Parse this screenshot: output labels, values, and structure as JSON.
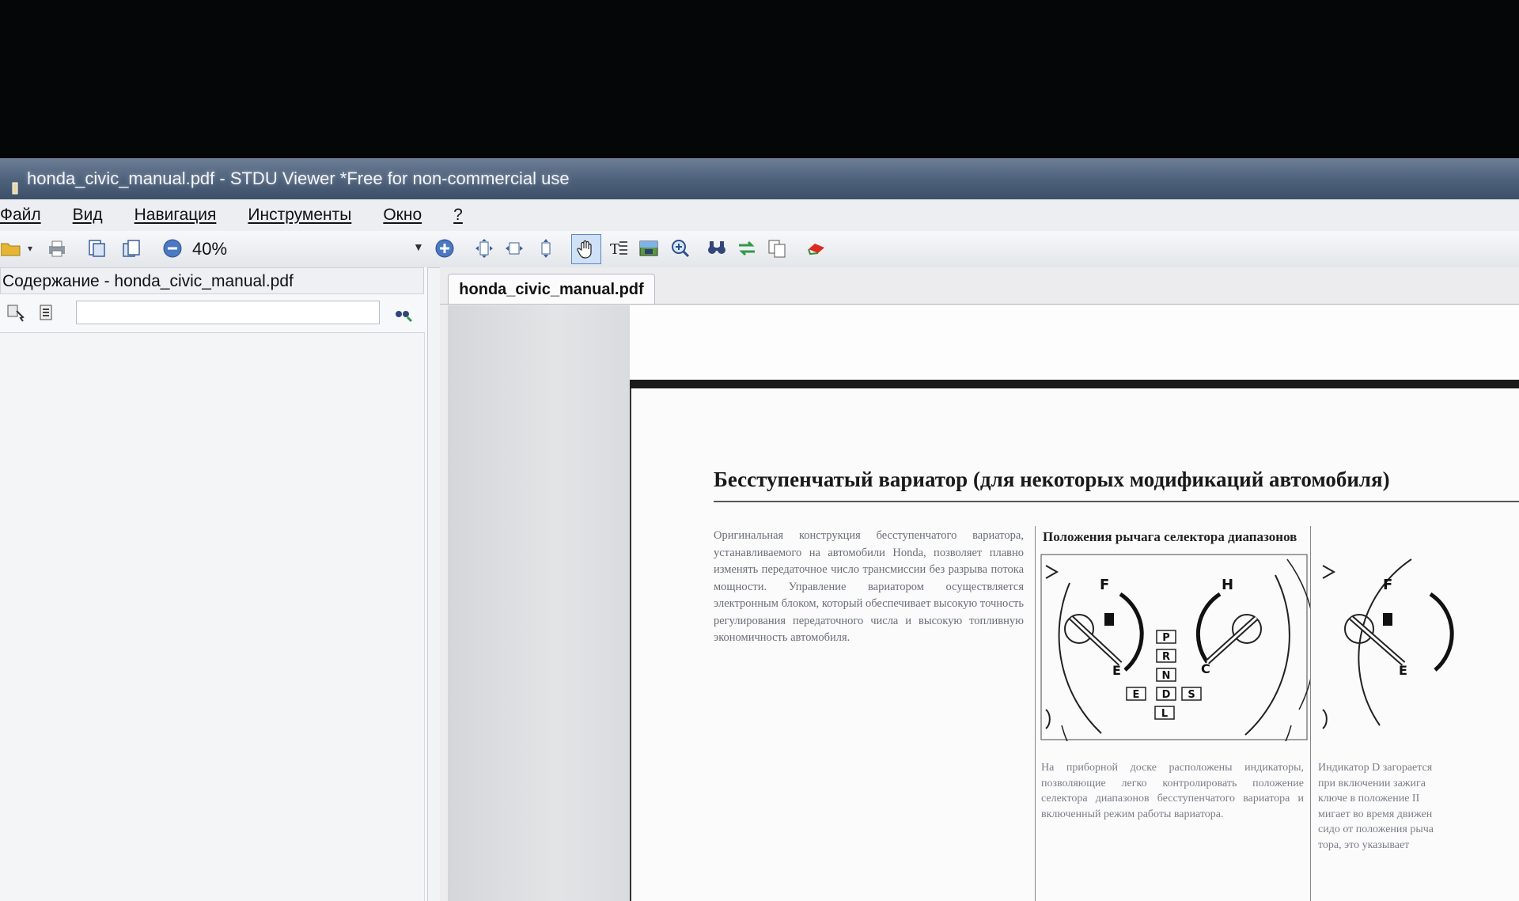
{
  "window": {
    "title": "honda_civic_manual.pdf - STDU Viewer *Free for non-commercial use"
  },
  "menu": {
    "items": [
      "Файл",
      "Вид",
      "Навигация",
      "Инструменты",
      "Окно",
      "?"
    ]
  },
  "toolbar": {
    "zoom": "40%"
  },
  "sidebar": {
    "title": "Содержание - honda_civic_manual.pdf",
    "search_value": ""
  },
  "document": {
    "tab_label": "honda_civic_manual.pdf",
    "heading": "Бесступенчатый вариатор (для некоторых модификаций автомобиля)",
    "intro": "Оригинальная конструкция бесступенчатого вариатора, устанавливаемого на автомобили Honda, позволяет плавно изменять передаточное число трансмиссии без разрыва потока мощности. Управление вариатором осуществляется электронным блоком, который обеспечивает высокую точность регулирования передаточного числа и высокую топливную экономичность автомобиля.",
    "figure_title": "Положения рычага селектора диапазонов",
    "gauge": {
      "fuel_full": "F",
      "fuel_empty": "E",
      "temp_hot": "H",
      "temp_cold": "C",
      "gears": [
        "P",
        "R",
        "N",
        "E",
        "D",
        "S",
        "L"
      ]
    },
    "gauge2": {
      "fuel_full": "F",
      "fuel_empty": "E"
    },
    "caption": "На приборной доске расположены индикаторы, позволяющие легко контролировать положение селектора диапазонов бесступенчатого вариатора и включенный режим работы вариатора.",
    "caption2": [
      "Индикатор D загорается",
      "при включении зажига",
      "ключе в положение II",
      "мигает во время движен",
      "сидо от положения рыча",
      "тора, это указывает"
    ]
  }
}
